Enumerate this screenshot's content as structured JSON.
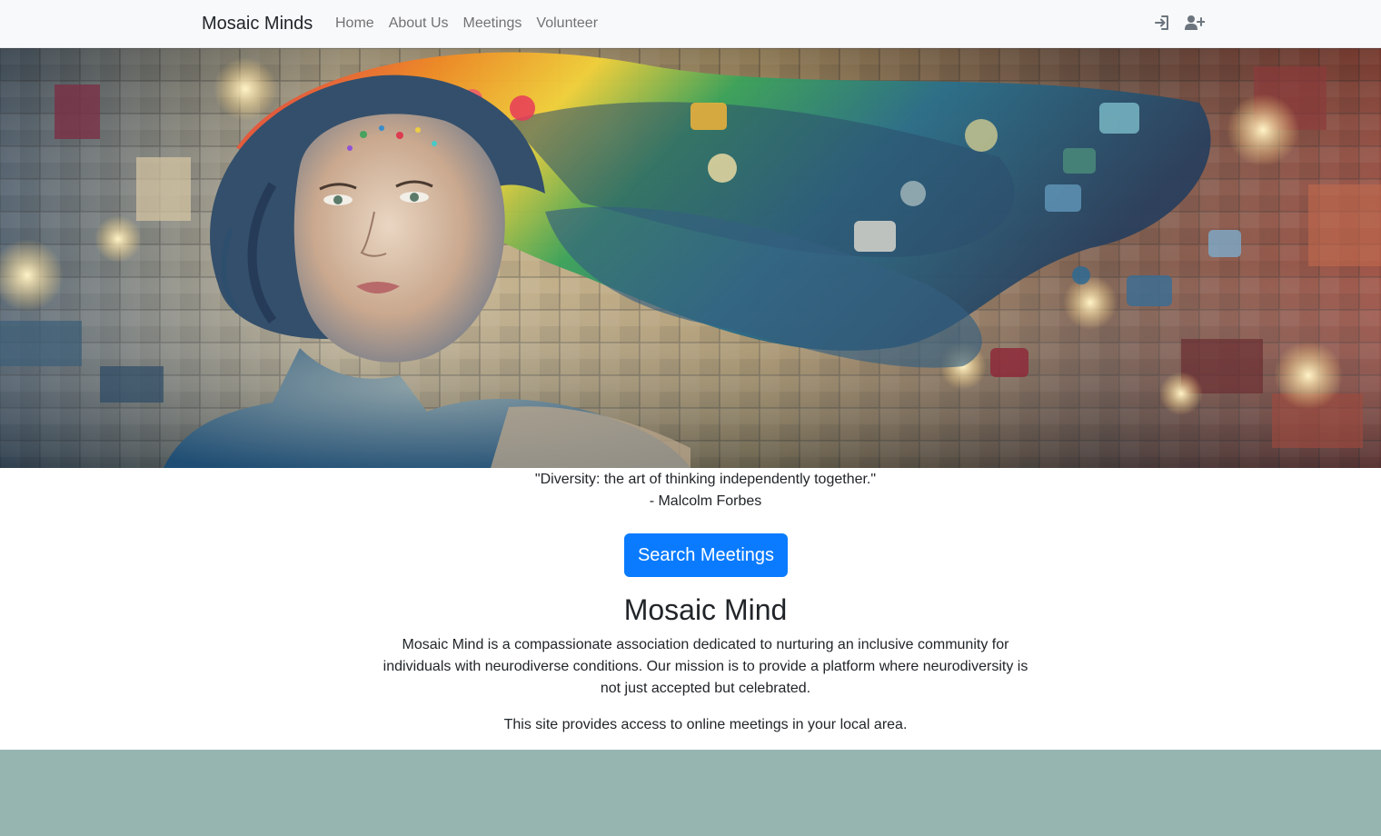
{
  "navbar": {
    "brand": "Mosaic Minds",
    "links": [
      "Home",
      "About Us",
      "Meetings",
      "Volunteer"
    ],
    "icons": [
      "login-icon",
      "user-plus-icon"
    ]
  },
  "hero": {
    "icon": "mosaic-portrait-image"
  },
  "quote": {
    "text": "\"Diversity: the art of thinking independently together.\"",
    "author": "- Malcolm Forbes"
  },
  "cta": {
    "label": "Search Meetings",
    "color": "#0a7bff"
  },
  "about": {
    "title": "Mosaic Mind",
    "description": "Mosaic Mind is a compassionate association dedicated to nurturing an inclusive community for individuals with neurodiverse conditions. Our mission is to provide a platform where neurodiversity is not just accepted but celebrated.",
    "note": "This site provides access to online meetings in your local area."
  },
  "footer": {
    "color": "#96b5b1"
  }
}
